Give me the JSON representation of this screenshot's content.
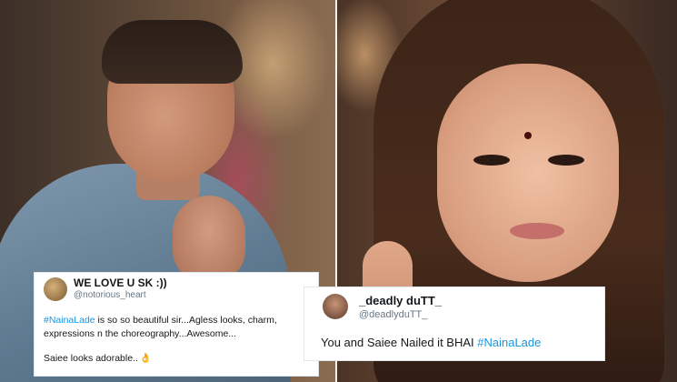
{
  "tweets": [
    {
      "display_name": "WE LOVE U SK :))",
      "handle": "@notorious_heart",
      "hashtag": "#NainaLade",
      "text_after_hashtag": " is so so beautiful sir...Agless looks, charm, expressions n the choreography...Awesome...",
      "second_paragraph": "Saiee looks adorable..",
      "emoji": "👌"
    },
    {
      "display_name": "_deadly duTT_",
      "handle": "@deadlyduTT_",
      "text_before_hashtag": "You and Saiee Nailed it BHAI ",
      "hashtag": "#NainaLade"
    }
  ],
  "colors": {
    "hashtag": "#1b95e0",
    "handle": "#657786",
    "text": "#14171a"
  }
}
